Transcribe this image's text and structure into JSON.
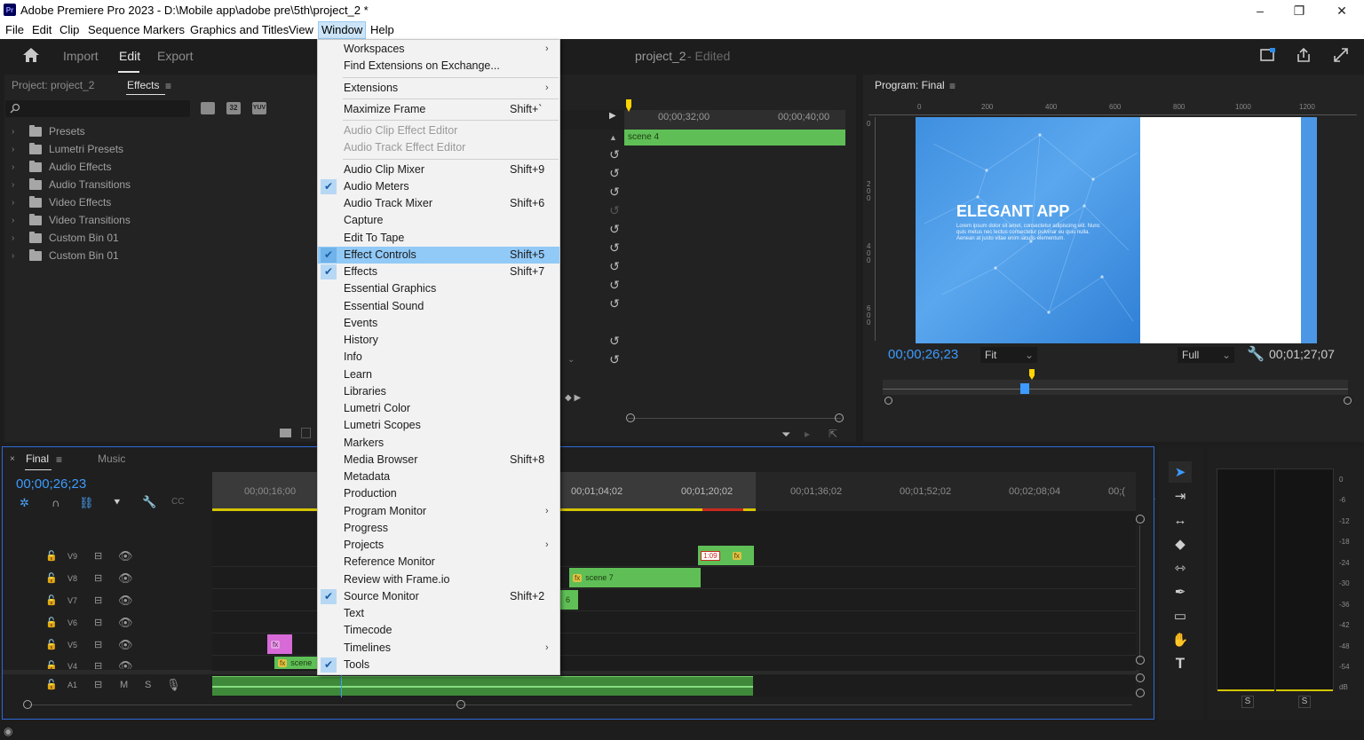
{
  "window": {
    "title": "Adobe Premiere Pro 2023 - D:\\Mobile app\\adobe pre\\5th\\project_2 *",
    "app_badge": "Pr",
    "minimize": "–",
    "restore": "❐",
    "close": "✕"
  },
  "menubar": [
    "File",
    "Edit",
    "Clip",
    "Sequence",
    "Markers",
    "Graphics and Titles",
    "View",
    "Window",
    "Help"
  ],
  "workspace": {
    "tabs": [
      "Import",
      "Edit",
      "Export"
    ],
    "active_tab": "Edit",
    "project_name": "project_2",
    "project_status": "- Edited"
  },
  "project_panel": {
    "tab_project": "Project: project_2",
    "tab_effects": "Effects",
    "search_placeholder": "",
    "tree": [
      "Presets",
      "Lumetri Presets",
      "Audio Effects",
      "Audio Transitions",
      "Video Effects",
      "Video Transitions",
      "Custom Bin 01",
      "Custom Bin 01"
    ]
  },
  "source_panel": {
    "ruler": [
      "00;00;32;00",
      "00;00;40;00"
    ],
    "clip_label": "scene 4"
  },
  "window_menu": [
    {
      "label": "Workspaces",
      "submenu": true
    },
    {
      "label": "Find Extensions on Exchange..."
    },
    {
      "sep": true
    },
    {
      "label": "Extensions",
      "submenu": true
    },
    {
      "sep": true
    },
    {
      "label": "Maximize Frame",
      "shortcut": "Shift+`"
    },
    {
      "sep": true
    },
    {
      "label": "Audio Clip Effect Editor",
      "disabled": true
    },
    {
      "label": "Audio Track Effect Editor",
      "disabled": true
    },
    {
      "sep": true
    },
    {
      "label": "Audio Clip Mixer",
      "shortcut": "Shift+9"
    },
    {
      "label": "Audio Meters",
      "checked": true
    },
    {
      "label": "Audio Track Mixer",
      "shortcut": "Shift+6"
    },
    {
      "label": "Capture"
    },
    {
      "label": "Edit To Tape"
    },
    {
      "label": "Effect Controls",
      "shortcut": "Shift+5",
      "checked": true,
      "highlighted": true
    },
    {
      "label": "Effects",
      "shortcut": "Shift+7",
      "checked": true
    },
    {
      "label": "Essential Graphics"
    },
    {
      "label": "Essential Sound"
    },
    {
      "label": "Events"
    },
    {
      "label": "History"
    },
    {
      "label": "Info"
    },
    {
      "label": "Learn"
    },
    {
      "label": "Libraries"
    },
    {
      "label": "Lumetri Color"
    },
    {
      "label": "Lumetri Scopes"
    },
    {
      "label": "Markers"
    },
    {
      "label": "Media Browser",
      "shortcut": "Shift+8"
    },
    {
      "label": "Metadata"
    },
    {
      "label": "Production"
    },
    {
      "label": "Program Monitor",
      "submenu": true
    },
    {
      "label": "Progress"
    },
    {
      "label": "Projects",
      "submenu": true
    },
    {
      "label": "Reference Monitor"
    },
    {
      "label": "Review with Frame.io"
    },
    {
      "label": "Source Monitor",
      "shortcut": "Shift+2",
      "checked": true
    },
    {
      "label": "Text"
    },
    {
      "label": "Timecode"
    },
    {
      "label": "Timelines",
      "submenu": true
    },
    {
      "label": "Tools",
      "checked": true
    }
  ],
  "program_monitor": {
    "title": "Program: Final",
    "ruler": [
      "0",
      "200",
      "400",
      "600",
      "800",
      "1000",
      "1200"
    ],
    "vruler": [
      "0",
      "2\n0\n0",
      "4\n0\n0",
      "6\n0\n0"
    ],
    "timecode": "00;00;26;23",
    "fit": "Fit",
    "quality": "Full",
    "duration": "00;01;27;07",
    "video_title": "ELEGANT APP",
    "video_body": "Lorem ipsum dolor sit amet, consectetur adipiscing elit. Nunc quis metus nec lectus consectetur pulvinar eu quis nulla. Aenean at justo vitae enim iaculis elementum."
  },
  "timeline": {
    "tab": "Final",
    "tab2": "Music",
    "timecode": "00;00;26;23",
    "ruler": [
      "00;00;16;00",
      "00;01;04;02",
      "00;01;20;02",
      "00;01;36;02",
      "00;01;52;02",
      "00;02;08;04",
      "00;("
    ],
    "tracks": [
      "V9",
      "V8",
      "V7",
      "V6",
      "V5",
      "V4",
      "A1"
    ],
    "clips": {
      "scene7": "scene 7",
      "scene_v7": "6",
      "scene_v4": "scene",
      "fx": "fx",
      "red_badge": "1:09"
    },
    "audio_m": "M",
    "audio_s": "S"
  },
  "audio_meter": {
    "ticks": [
      "0",
      "-6",
      "-12",
      "-18",
      "-24",
      "-30",
      "-36",
      "-42",
      "-48",
      "-54",
      "dB"
    ],
    "solo_left": "S",
    "solo_right": "S"
  },
  "colors": {
    "accent_blue": "#2d8ceb",
    "clip_green": "#5fbf56",
    "clip_pink": "#d86ad8",
    "menu_highlight": "#91c9f7"
  }
}
